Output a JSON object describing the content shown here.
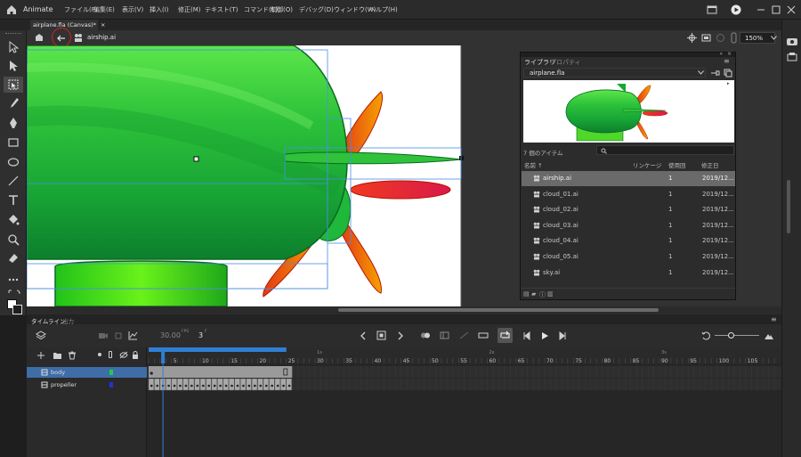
{
  "app": {
    "name": "Animate"
  },
  "menu": [
    "ファイル(F)",
    "編集(E)",
    "表示(V)",
    "挿入(I)",
    "修正(M)",
    "テキスト(T)",
    "コマンド(C)",
    "制御(O)",
    "デバッグ(D)",
    "ウィンドウ(W)",
    "ヘルプ(H)"
  ],
  "document_tab": {
    "label": "airplane.fla (Canvas)*",
    "close": "×"
  },
  "editbar": {
    "symbol_name": "airship.ai",
    "zoom": "150%"
  },
  "library": {
    "tabs": [
      "ライブラリ",
      "プロパティ"
    ],
    "file": "airplane.fla",
    "item_count": "7 個のアイテム",
    "columns": [
      "名前 ↑",
      "リンケージ",
      "使用回",
      "修正日"
    ],
    "items": [
      {
        "name": "airship.ai",
        "count": "1",
        "date": "2019/12..."
      },
      {
        "name": "cloud_01.ai",
        "count": "1",
        "date": "2019/12..."
      },
      {
        "name": "cloud_02.ai",
        "count": "1",
        "date": "2019/12..."
      },
      {
        "name": "cloud_03.ai",
        "count": "1",
        "date": "2019/12..."
      },
      {
        "name": "cloud_04.ai",
        "count": "1",
        "date": "2019/12..."
      },
      {
        "name": "cloud_05.ai",
        "count": "1",
        "date": "2019/12..."
      },
      {
        "name": "sky.ai",
        "count": "1",
        "date": "2019/12..."
      }
    ]
  },
  "timeline": {
    "tabs": [
      "タイムライン",
      "出力"
    ],
    "fps": "30.00",
    "fps_unit": "FPS",
    "frame": "3",
    "frame_unit": "F",
    "layers": [
      {
        "name": "body",
        "color": "#22cc44"
      },
      {
        "name": "propeller",
        "color": "#2233cc"
      }
    ],
    "ruler": [
      "5",
      "10",
      "15",
      "20",
      "25",
      "30",
      "35",
      "40",
      "45",
      "50",
      "55",
      "60",
      "65",
      "70",
      "75",
      "80",
      "85",
      "90",
      "95",
      "100",
      "105"
    ],
    "marks": [
      "1s",
      "2s",
      "3s"
    ]
  },
  "colors": {
    "accent": "#2f7fd4",
    "selection": "#3e6da8",
    "annotation": "#d62020"
  }
}
